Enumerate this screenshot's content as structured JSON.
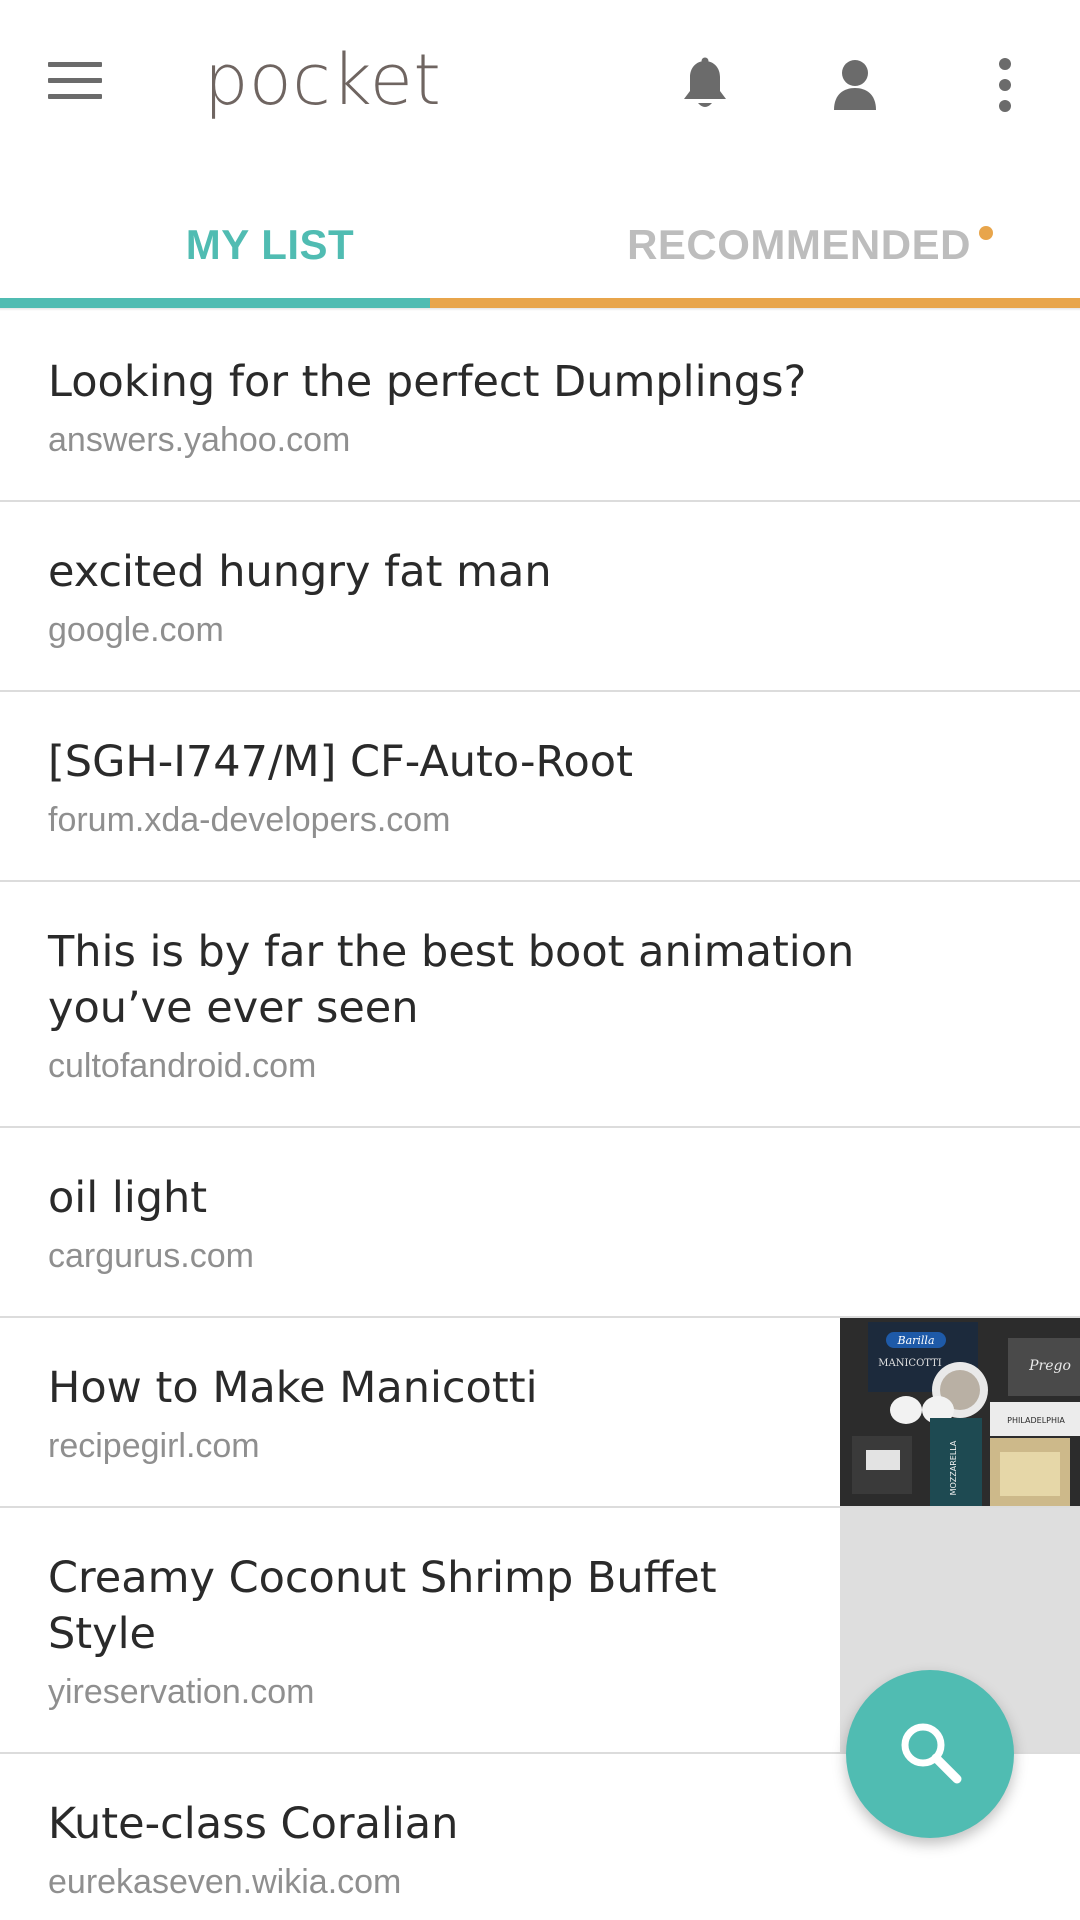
{
  "app": {
    "logo_text": "pocket"
  },
  "tabs": [
    {
      "label": "MY LIST",
      "active": true
    },
    {
      "label": "RECOMMENDED",
      "active": false,
      "has_badge": true
    }
  ],
  "items": [
    {
      "title": "Looking for the perfect Dumplings?",
      "domain": "answers.yahoo.com"
    },
    {
      "title": "excited hungry fat man",
      "domain": "google.com"
    },
    {
      "title": "[SGH-I747/M] CF-Auto-Root",
      "domain": "forum.xda-developers.com"
    },
    {
      "title": "This is by far the best boot animation you’ve ever seen",
      "domain": "cultofandroid.com"
    },
    {
      "title": "oil light",
      "domain": "cargurus.com"
    },
    {
      "title": "How to Make Manicotti",
      "domain": "recipegirl.com",
      "thumbnail": "manicotti-ingredients"
    },
    {
      "title": "Creamy Coconut Shrimp Buffet Style",
      "domain": "yireservation.com",
      "thumbnail": "placeholder"
    },
    {
      "title": "Kute-class Coralian",
      "domain": "eurekaseven.wikia.com"
    }
  ],
  "thumbnail_text": {
    "brand1": "Barilla",
    "label1": "MANICOTTI",
    "brand2": "Prego",
    "label2": "PHILADELPHIA",
    "label3": "MOZZARELLA"
  },
  "colors": {
    "accent_teal": "#50bcb2",
    "accent_orange": "#e8a54b",
    "text_primary": "#2a2a2a",
    "text_secondary": "#8f8f8f"
  },
  "icons": {
    "menu": "hamburger-menu-icon",
    "bell": "bell-icon",
    "profile": "person-icon",
    "overflow": "more-vertical-icon",
    "fab": "search-icon"
  }
}
